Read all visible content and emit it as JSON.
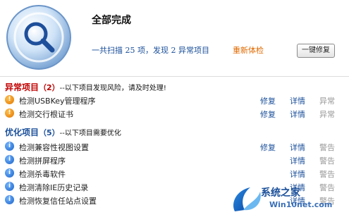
{
  "header": {
    "title": "全部完成",
    "summary": {
      "prefix": "一共扫描",
      "scanned": "25",
      "unit1": "项，发现",
      "found": "2",
      "unit2": "异常项目"
    },
    "recheck_label": "重新体检",
    "onekey_label": "一键修复"
  },
  "abnormal": {
    "name": "异常项目",
    "count": "（2）",
    "note": "--以下项目发现风险，请及时处理!",
    "items": [
      {
        "label": "检测USBKey管理程序",
        "fix": "修复",
        "detail": "详情",
        "state": "异常"
      },
      {
        "label": "检测交行根证书",
        "fix": "修复",
        "detail": "详情",
        "state": "异常"
      }
    ]
  },
  "optimize": {
    "name": "优化项目",
    "count": "（5）",
    "note": "--以下项目需要优化",
    "items": [
      {
        "label": "检测兼容性视图设置",
        "fix": "修复",
        "detail": "详情",
        "state": "警告"
      },
      {
        "label": "检测拼屏程序",
        "detail": "详情",
        "state": "警告"
      },
      {
        "label": "检测杀毒软件",
        "detail": "详情",
        "state": "警告"
      },
      {
        "label": "检测清除IE历史记录",
        "detail": "详情",
        "state": "警告"
      },
      {
        "label": "检测恢复信任站点设置",
        "detail": "详情",
        "state": "警告"
      }
    ]
  },
  "watermark": {
    "line1": "系统之家",
    "line2": "Win10net.com"
  },
  "colors": {
    "accent_blue": "#1a4f9a",
    "warn_red": "#c00000",
    "recheck_orange": "#e06a00"
  },
  "icons": {
    "logo": "magnifier-icon",
    "abnormal_item": "exclamation-warning-icon",
    "optimize_item": "info-icon"
  }
}
